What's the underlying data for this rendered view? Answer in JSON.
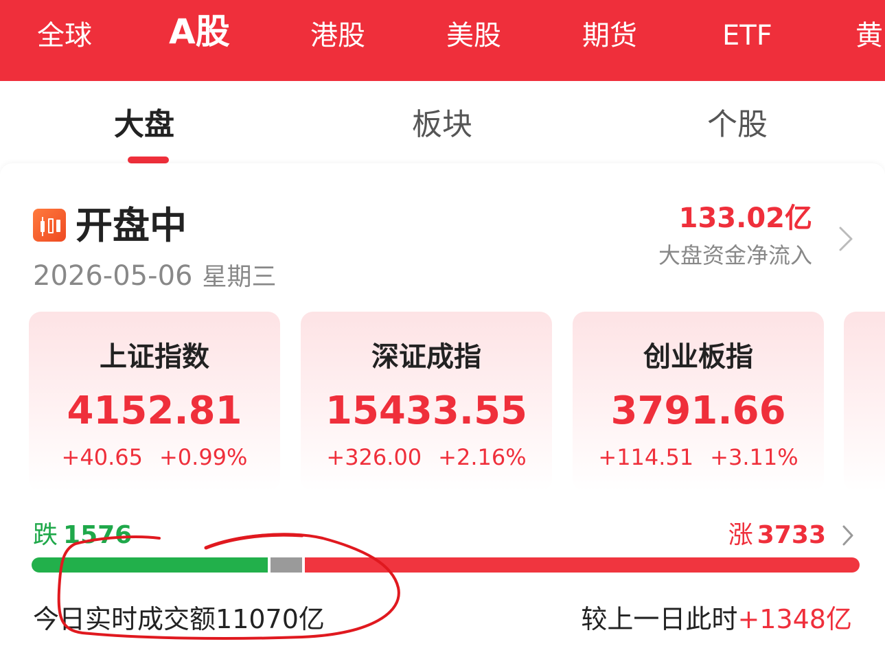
{
  "market_tabs": [
    {
      "label": "全球",
      "active": false
    },
    {
      "label": "A股",
      "active": true
    },
    {
      "label": "港股",
      "active": false
    },
    {
      "label": "美股",
      "active": false
    },
    {
      "label": "期货",
      "active": false
    },
    {
      "label": "ETF",
      "active": false
    },
    {
      "label": "黄",
      "active": false
    }
  ],
  "sub_tabs": [
    {
      "label": "大盘",
      "active": true
    },
    {
      "label": "板块",
      "active": false
    },
    {
      "label": "个股",
      "active": false
    }
  ],
  "overview": {
    "status": "开盘中",
    "date": "2026-05-06",
    "weekday": "星期三",
    "fund_flow_amount": "133.02亿",
    "fund_flow_label": "大盘资金净流入"
  },
  "indices": [
    {
      "name": "上证指数",
      "value": "4152.81",
      "change": "+40.65",
      "percent": "+0.99%"
    },
    {
      "name": "深证成指",
      "value": "15433.55",
      "change": "+326.00",
      "percent": "+2.16%"
    },
    {
      "name": "创业板指",
      "value": "3791.66",
      "change": "+114.51",
      "percent": "+3.11%"
    }
  ],
  "breadth": {
    "fall_label": "跌",
    "fall_count": "1576",
    "rise_label": "涨",
    "rise_count": "3733",
    "fall_fraction": 0.285,
    "flat_fraction": 0.038,
    "rise_fraction": 0.677
  },
  "turnover": {
    "label": "今日实时成交额",
    "amount": "11070",
    "unit": "亿",
    "compare_label": "较上一日此时",
    "compare_delta": "+1348",
    "compare_unit": "亿"
  },
  "colors": {
    "brand_red": "#ef2f3b",
    "rise": "#ef2f3b",
    "fall": "#1fa84a",
    "flat": "#9a9a9a",
    "annotation": "#e0191f"
  },
  "icons": {
    "status_icon": "candlestick-icon",
    "flow_chevron": "chevron-right-icon",
    "breadth_chevron": "chevron-right-icon"
  }
}
